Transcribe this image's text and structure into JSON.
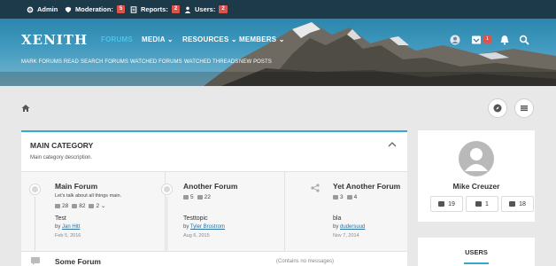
{
  "admin_bar": {
    "admin_label": "Admin",
    "moderation_label": "Moderation:",
    "moderation_count": "5",
    "reports_label": "Reports:",
    "reports_count": "2",
    "users_label": "Users:",
    "users_count": "2"
  },
  "header": {
    "logo": "XENITH",
    "nav": [
      {
        "label": "FORUMS",
        "active": true
      },
      {
        "label": "MEDIA ⌄"
      },
      {
        "label": "RESOURCES ⌄"
      },
      {
        "label": "MEMBERS ⌄"
      }
    ],
    "subnav": [
      "MARK FORUMS READ",
      "SEARCH FORUMS",
      "WATCHED FORUMS",
      "WATCHED THREADS",
      "NEW POSTS"
    ],
    "inbox_badge": "1",
    "icons": [
      "user-icon",
      "inbox-icon",
      "bell-icon",
      "search-icon"
    ]
  },
  "breadcrumb": {
    "icons": [
      "home-icon",
      "compass-icon",
      "menu-icon"
    ]
  },
  "category": {
    "title": "MAIN CATEGORY",
    "description": "Main category description.",
    "forums": [
      {
        "title": "Main Forum",
        "description": "Let's talk about all things main.",
        "threads": "28",
        "messages": "82",
        "extra": "2 ⌄",
        "last_title": "Test",
        "by": "by",
        "last_user": "Jan Hitt",
        "last_date": "Feb 5, 2016"
      },
      {
        "title": "Another Forum",
        "description": "",
        "threads": "5",
        "messages": "22",
        "extra": "",
        "last_title": "Testtopic",
        "by": "by",
        "last_user": "Tyler Brostrom",
        "last_date": "Aug 6, 2015"
      },
      {
        "title": "Yet Another Forum",
        "description": "",
        "threads": "3",
        "messages": "4",
        "extra": "",
        "last_title": "bla",
        "by": "by",
        "last_user": "dudersuud",
        "last_date": "Nov 7, 2014"
      }
    ],
    "row2": {
      "title": "Some Forum",
      "empty": "(Contains no messages)"
    }
  },
  "sidebar": {
    "user_name": "Mike Creuzer",
    "stats": [
      {
        "icon": "message-icon",
        "value": "19"
      },
      {
        "icon": "like-icon",
        "value": "1"
      },
      {
        "icon": "trophy-icon",
        "value": "18"
      }
    ],
    "users_title": "USERS"
  },
  "colors": {
    "accent": "#35a7d2",
    "admin_bar": "#1d3a4b",
    "badge": "#d9534f"
  }
}
